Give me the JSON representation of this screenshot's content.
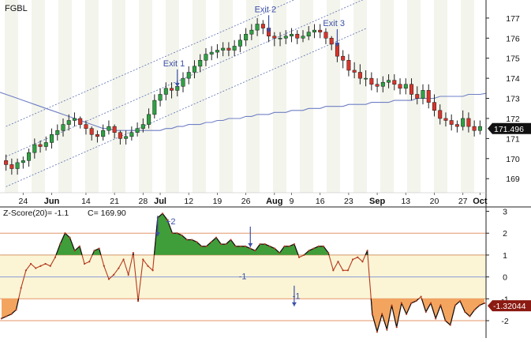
{
  "chart_data": [
    {
      "type": "candlestick",
      "title": "FGBL",
      "y_ticks": [
        169,
        170,
        171,
        172,
        173,
        174,
        175,
        176,
        177
      ],
      "ylim": [
        168.3,
        177.9
      ],
      "last_price_label": "171.496",
      "x_labels": [
        {
          "i": 3,
          "text": "24"
        },
        {
          "i": 8,
          "text": "Jun"
        },
        {
          "i": 14,
          "text": "14"
        },
        {
          "i": 19,
          "text": "21"
        },
        {
          "i": 24,
          "text": "28"
        },
        {
          "i": 27,
          "text": "Jul"
        },
        {
          "i": 32,
          "text": "12"
        },
        {
          "i": 37,
          "text": "19"
        },
        {
          "i": 42,
          "text": "26"
        },
        {
          "i": 47,
          "text": "Aug"
        },
        {
          "i": 50,
          "text": "9"
        },
        {
          "i": 55,
          "text": "16"
        },
        {
          "i": 60,
          "text": "23"
        },
        {
          "i": 65,
          "text": "Sep"
        },
        {
          "i": 70,
          "text": "13"
        },
        {
          "i": 75,
          "text": "20"
        },
        {
          "i": 80,
          "text": "27"
        },
        {
          "i": 83,
          "text": "Oct"
        }
      ],
      "candles": {
        "open": [
          169.9,
          169.7,
          169.5,
          169.8,
          169.9,
          170.3,
          170.7,
          170.6,
          170.8,
          171.2,
          171.4,
          171.7,
          171.9,
          172.0,
          171.7,
          171.5,
          171.2,
          171.1,
          171.4,
          171.6,
          171.3,
          171.0,
          171.1,
          171.3,
          171.5,
          171.7,
          172.2,
          172.9,
          173.2,
          173.5,
          173.4,
          173.6,
          174.0,
          174.3,
          174.6,
          174.9,
          175.2,
          175.3,
          175.4,
          175.5,
          175.4,
          175.6,
          175.9,
          176.2,
          176.4,
          176.7,
          176.5,
          176.1,
          176.0,
          176.0,
          176.1,
          176.2,
          176.0,
          176.1,
          176.3,
          176.4,
          176.3,
          176.0,
          175.7,
          175.1,
          174.9,
          174.4,
          174.3,
          174.0,
          174.0,
          173.7,
          173.6,
          173.8,
          173.9,
          173.7,
          173.5,
          173.7,
          173.2,
          173.0,
          173.4,
          172.8,
          172.4,
          172.0,
          171.9,
          171.7,
          171.6,
          172.0,
          171.6,
          171.4
        ],
        "close": [
          169.7,
          169.5,
          169.8,
          169.9,
          170.3,
          170.7,
          170.6,
          170.8,
          171.2,
          171.4,
          171.7,
          171.9,
          172.0,
          171.7,
          171.5,
          171.2,
          171.1,
          171.4,
          171.6,
          171.3,
          171.0,
          171.1,
          171.3,
          171.5,
          171.7,
          172.2,
          172.9,
          173.2,
          173.5,
          173.4,
          173.6,
          174.0,
          174.3,
          174.6,
          174.9,
          175.2,
          175.3,
          175.4,
          175.5,
          175.4,
          175.6,
          175.9,
          176.2,
          176.4,
          176.7,
          176.5,
          176.1,
          176.0,
          176.0,
          176.1,
          176.2,
          176.0,
          176.1,
          176.3,
          176.4,
          176.3,
          176.0,
          175.7,
          175.1,
          174.9,
          174.4,
          174.3,
          174.0,
          174.0,
          173.7,
          173.6,
          173.8,
          173.9,
          173.7,
          173.5,
          173.7,
          173.2,
          173.0,
          173.4,
          172.8,
          172.4,
          172.0,
          171.9,
          171.7,
          171.6,
          172.0,
          171.6,
          171.4,
          171.6
        ],
        "high": [
          170.2,
          170.0,
          170.0,
          170.1,
          170.5,
          171.0,
          170.9,
          171.1,
          171.5,
          171.7,
          172.0,
          172.2,
          172.3,
          172.1,
          171.9,
          171.6,
          171.4,
          171.7,
          171.9,
          171.7,
          171.4,
          171.4,
          171.6,
          171.8,
          172.0,
          172.5,
          173.2,
          173.5,
          173.8,
          173.8,
          173.9,
          174.3,
          174.6,
          174.9,
          175.2,
          175.5,
          175.6,
          175.7,
          175.8,
          175.8,
          175.9,
          176.2,
          176.5,
          176.7,
          177.0,
          176.9,
          176.6,
          176.3,
          176.3,
          176.4,
          176.5,
          176.4,
          176.4,
          176.6,
          176.7,
          176.7,
          176.5,
          176.1,
          175.8,
          175.4,
          175.2,
          174.8,
          174.7,
          174.4,
          174.3,
          174.0,
          174.1,
          174.2,
          174.2,
          174.0,
          174.0,
          174.0,
          173.6,
          173.7,
          173.7,
          173.2,
          172.7,
          172.3,
          172.2,
          171.9,
          172.4,
          172.3,
          171.9,
          171.9
        ],
        "low": [
          169.4,
          169.2,
          169.2,
          169.5,
          169.6,
          170.0,
          170.3,
          170.4,
          170.5,
          170.9,
          171.1,
          171.4,
          171.6,
          171.5,
          171.2,
          170.9,
          170.8,
          170.9,
          171.2,
          171.0,
          170.7,
          170.7,
          170.9,
          171.1,
          171.3,
          171.5,
          172.0,
          172.6,
          172.9,
          173.0,
          173.1,
          173.3,
          173.7,
          174.0,
          174.3,
          174.6,
          174.9,
          175.0,
          175.1,
          175.1,
          175.1,
          175.3,
          175.6,
          175.9,
          176.1,
          176.2,
          175.8,
          175.6,
          175.6,
          175.7,
          175.8,
          175.7,
          175.8,
          175.9,
          176.0,
          176.0,
          175.7,
          175.4,
          174.8,
          174.5,
          174.1,
          174.0,
          173.7,
          173.6,
          173.4,
          173.3,
          173.3,
          173.5,
          173.4,
          173.2,
          173.2,
          172.9,
          172.7,
          172.7,
          172.5,
          172.1,
          171.7,
          171.6,
          171.4,
          171.3,
          171.4,
          171.3,
          171.1,
          171.2
        ]
      },
      "moving_average": {
        "name": "",
        "color": "#6f7fc4",
        "values": [
          173.2,
          173.1,
          173.0,
          172.9,
          172.8,
          172.7,
          172.6,
          172.5,
          172.4,
          172.3,
          172.2,
          172.1,
          172.0,
          171.9,
          171.8,
          171.7,
          171.6,
          171.5,
          171.5,
          171.4,
          171.4,
          171.4,
          171.4,
          171.4,
          171.4,
          171.4,
          171.4,
          171.4,
          171.5,
          171.5,
          171.6,
          171.6,
          171.7,
          171.7,
          171.7,
          171.8,
          171.8,
          171.9,
          171.9,
          172.0,
          172.0,
          172.0,
          172.1,
          172.1,
          172.2,
          172.2,
          172.2,
          172.3,
          172.3,
          172.3,
          172.4,
          172.4,
          172.4,
          172.5,
          172.5,
          172.5,
          172.6,
          172.6,
          172.6,
          172.6,
          172.7,
          172.7,
          172.7,
          172.7,
          172.8,
          172.8,
          172.8,
          172.8,
          172.9,
          172.9,
          172.9,
          172.9,
          173.0,
          173.0,
          173.0,
          173.0,
          173.1,
          173.1,
          173.1,
          173.1,
          173.1,
          173.2,
          173.2,
          173.2
        ]
      },
      "channel": {
        "start_i": 0,
        "end_i": 83,
        "lower_start": 168.6,
        "lower_slope": 0.125,
        "mid_offset": 1.5,
        "upper_offset": 3.0,
        "line_end_i": 63
      },
      "annotations": [
        {
          "text": "Exit 1",
          "i": 30,
          "price": 174.6
        },
        {
          "text": "Exit 2",
          "i": 46,
          "price": 177.3
        },
        {
          "text": "Exit 3",
          "i": 58,
          "price": 176.6
        }
      ],
      "colors": {
        "up": "#2ea043",
        "down": "#d9342b",
        "wick": "#222222",
        "channel": "#5a6fb0"
      }
    },
    {
      "type": "line",
      "title": "Z-Score(20)= -1.1",
      "subtitle": "C= 169.90",
      "y_ticks": [
        3,
        2,
        1,
        0,
        -1,
        -2
      ],
      "ylim": [
        -2.65,
        3.2
      ],
      "last_value_label": "-1.32044",
      "bands": {
        "upper_yellow": [
          0,
          1
        ],
        "lower_yellow": [
          -1,
          0
        ],
        "levels": [
          2,
          1,
          0,
          -1,
          -2
        ]
      },
      "level_labels": [
        {
          "text": "+2",
          "i": 33,
          "value": 2.4
        },
        {
          "text": "-1",
          "i": 48,
          "value": -0.1
        },
        {
          "text": "-1",
          "i": 59,
          "value": -1.0
        }
      ],
      "arrows": [
        {
          "i": 32,
          "value": 2.8
        },
        {
          "i": 51,
          "value": 2.3
        },
        {
          "i": 60,
          "value": -0.4
        }
      ],
      "series": [
        {
          "name": "",
          "values": [
            -1.9,
            -1.8,
            -1.7,
            -1.5,
            -0.5,
            0.3,
            0.6,
            0.4,
            0.5,
            0.6,
            0.5,
            0.9,
            1.5,
            2.0,
            1.8,
            1.2,
            1.4,
            0.6,
            0.7,
            1.2,
            1.3,
            0.5,
            -0.1,
            0.1,
            0.4,
            0.8,
            0.1,
            1.1,
            -1.1,
            0.8,
            0.5,
            0.3,
            2.7,
            2.9,
            2.6,
            2.0,
            2.0,
            1.9,
            1.7,
            1.7,
            1.6,
            1.4,
            1.4,
            1.6,
            1.8,
            1.5,
            1.5,
            1.7,
            1.4,
            1.4,
            1.4,
            1.3,
            1.2,
            1.5,
            1.5,
            1.4,
            1.3,
            1.1,
            1.4,
            1.4,
            1.5,
            0.9,
            1.0,
            1.2,
            1.3,
            1.4,
            1.4,
            1.1,
            0.3,
            0.7,
            0.3,
            0.3,
            0.8,
            0.9,
            0.7,
            1.2,
            -1.7,
            -2.5,
            -1.7,
            -2.4,
            -1.3,
            -2.3,
            -1.2,
            -1.7,
            -1.2,
            -1.1,
            -0.9,
            -1.6,
            -1.2,
            -1.9,
            -1.3,
            -2.0,
            -2.2,
            -1.3,
            -1.1,
            -1.6,
            -1.8,
            -1.5,
            -1.3,
            -1.2
          ],
          "color": "#b53a1f"
        }
      ],
      "colors": {
        "fill_above": "#3f9e3a",
        "fill_below": "#f3a55f",
        "yellow_band": "#fbf5d5",
        "level_line": "#e4956a"
      }
    }
  ]
}
